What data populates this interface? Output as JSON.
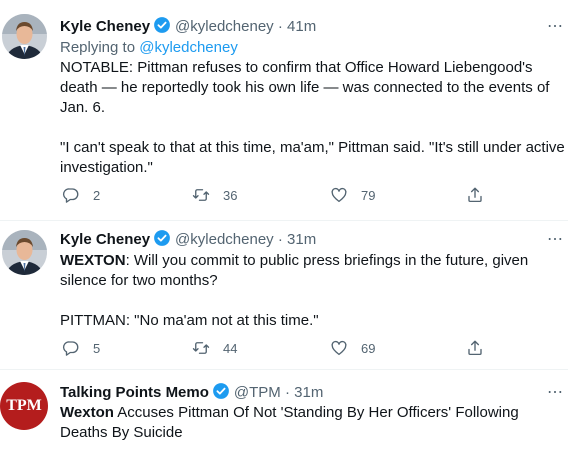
{
  "tweets": [
    {
      "name": "Kyle Cheney",
      "handle": "@kyledcheney",
      "time": "· 41m",
      "replying_prefix": "Replying to ",
      "replying_to": "@kyledcheney",
      "paragraph1": "NOTABLE: Pittman refuses to confirm that Office Howard Liebengood's death — he reportedly took his own life — was connected to the events of Jan. 6.",
      "paragraph2": "\"I can't speak to that at this time, ma'am,\" Pittman said. \"It's still under active investigation.\"",
      "replies": "2",
      "retweets": "36",
      "likes": "79"
    },
    {
      "name": "Kyle Cheney",
      "handle": "@kyledcheney",
      "time": "· 31m",
      "speaker": "WEXTON",
      "paragraph1_rest": ": Will you commit to public press briefings in the future, given silence for two months?",
      "paragraph2": "PITTMAN: \"No ma'am not at this time.\"",
      "replies": "5",
      "retweets": "44",
      "likes": "69"
    },
    {
      "name": "Talking Points Memo",
      "handle": "@TPM",
      "time": "· 31m",
      "avatar_text": "TPM",
      "headline_bold": "Wexton",
      "headline_rest": " Accuses Pittman Of Not 'Standing By Her Officers' Following Deaths By Suicide"
    }
  ],
  "icons": {
    "more": "more-icon",
    "verified": "verified-badge-icon",
    "reply": "reply-icon",
    "retweet": "retweet-icon",
    "like": "like-icon",
    "share": "share-icon"
  },
  "colors": {
    "accent": "#1d9bf0",
    "muted": "#536471",
    "tpm_red": "#b41d1d"
  }
}
